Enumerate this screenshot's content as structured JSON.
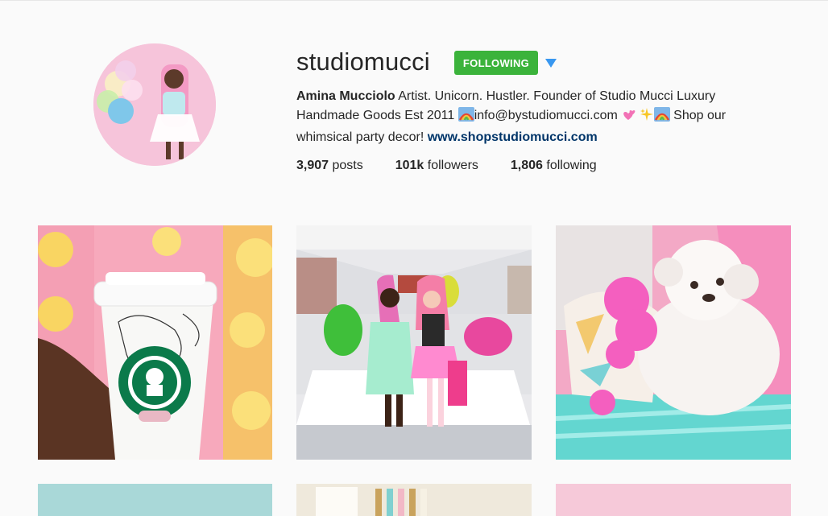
{
  "profile": {
    "username": "studiomucci",
    "follow_button": "FOLLOWING",
    "bio_name": "Amina Mucciolo",
    "bio_text_1": " Artist. Unicorn. Hustler. Founder of Studio Mucci Luxury Handmade Goods Est 2011 ",
    "bio_text_2": "info@bystudiomucci.com ",
    "bio_text_3": " Shop our whimsical party decor! ",
    "bio_link": "www.shopstudiomucci.com",
    "emoji_icons": [
      "rainbow-icon",
      "two-hearts-icon",
      "sparkles-icon",
      "rainbow-icon"
    ]
  },
  "stats": {
    "posts_count": "3,907",
    "posts_label": " posts",
    "followers_count": "101k",
    "followers_label": " followers",
    "following_count": "1,806",
    "following_label": " following"
  },
  "colors": {
    "follow_green": "#3bb33b",
    "link_blue": "#003569",
    "dropdown_blue": "#3897f0",
    "background": "#fafafa"
  },
  "posts": [
    {
      "name": "post-starbucks-cup"
    },
    {
      "name": "post-museum-balloons"
    },
    {
      "name": "post-white-dog"
    },
    {
      "name": "post-teal-partial"
    },
    {
      "name": "post-decor-partial"
    },
    {
      "name": "post-pink-partial"
    }
  ]
}
